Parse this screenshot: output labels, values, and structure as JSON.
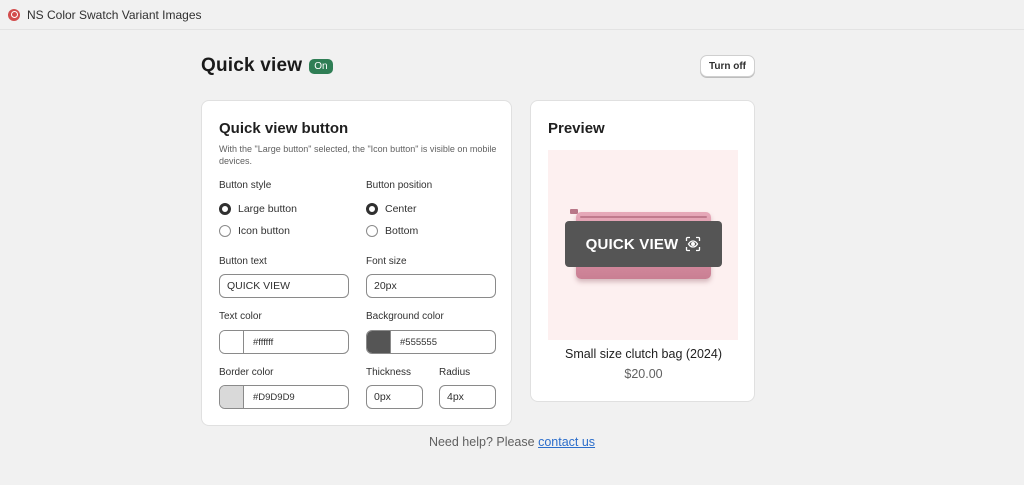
{
  "app": {
    "title": "NS Color Swatch Variant Images",
    "icon": "app-logo-icon"
  },
  "header": {
    "title": "Quick view",
    "status": "On",
    "toggle_label": "Turn off"
  },
  "settings": {
    "heading": "Quick view button",
    "hint": "With the \"Large button\" selected, the \"Icon button\" is visible on mobile devices.",
    "button_style": {
      "label": "Button style",
      "options": [
        {
          "label": "Large button",
          "checked": true
        },
        {
          "label": "Icon button",
          "checked": false
        }
      ]
    },
    "button_position": {
      "label": "Button position",
      "options": [
        {
          "label": "Center",
          "checked": true
        },
        {
          "label": "Bottom",
          "checked": false
        }
      ]
    },
    "button_text": {
      "label": "Button text",
      "value": "QUICK VIEW"
    },
    "font_size": {
      "label": "Font size",
      "value": "20px"
    },
    "text_color": {
      "label": "Text color",
      "value": "#ffffff",
      "swatch": "#ffffff"
    },
    "background_color": {
      "label": "Background color",
      "value": "#555555",
      "swatch": "#555555"
    },
    "border_color": {
      "label": "Border color",
      "value": "#D9D9D9",
      "swatch": "#D9D9D9"
    },
    "thickness": {
      "label": "Thickness",
      "value": "0px"
    },
    "radius": {
      "label": "Radius",
      "value": "4px"
    }
  },
  "preview": {
    "heading": "Preview",
    "button_label": "QUICK VIEW",
    "button_icon": "eye-scan-icon",
    "product_name": "Small size clutch bag (2024)",
    "product_price": "$20.00"
  },
  "footer": {
    "help_text": "Need help? Please ",
    "link_text": "contact us"
  },
  "colors": {
    "accent_green": "#2f7e55",
    "link_blue": "#2c6ecb"
  }
}
